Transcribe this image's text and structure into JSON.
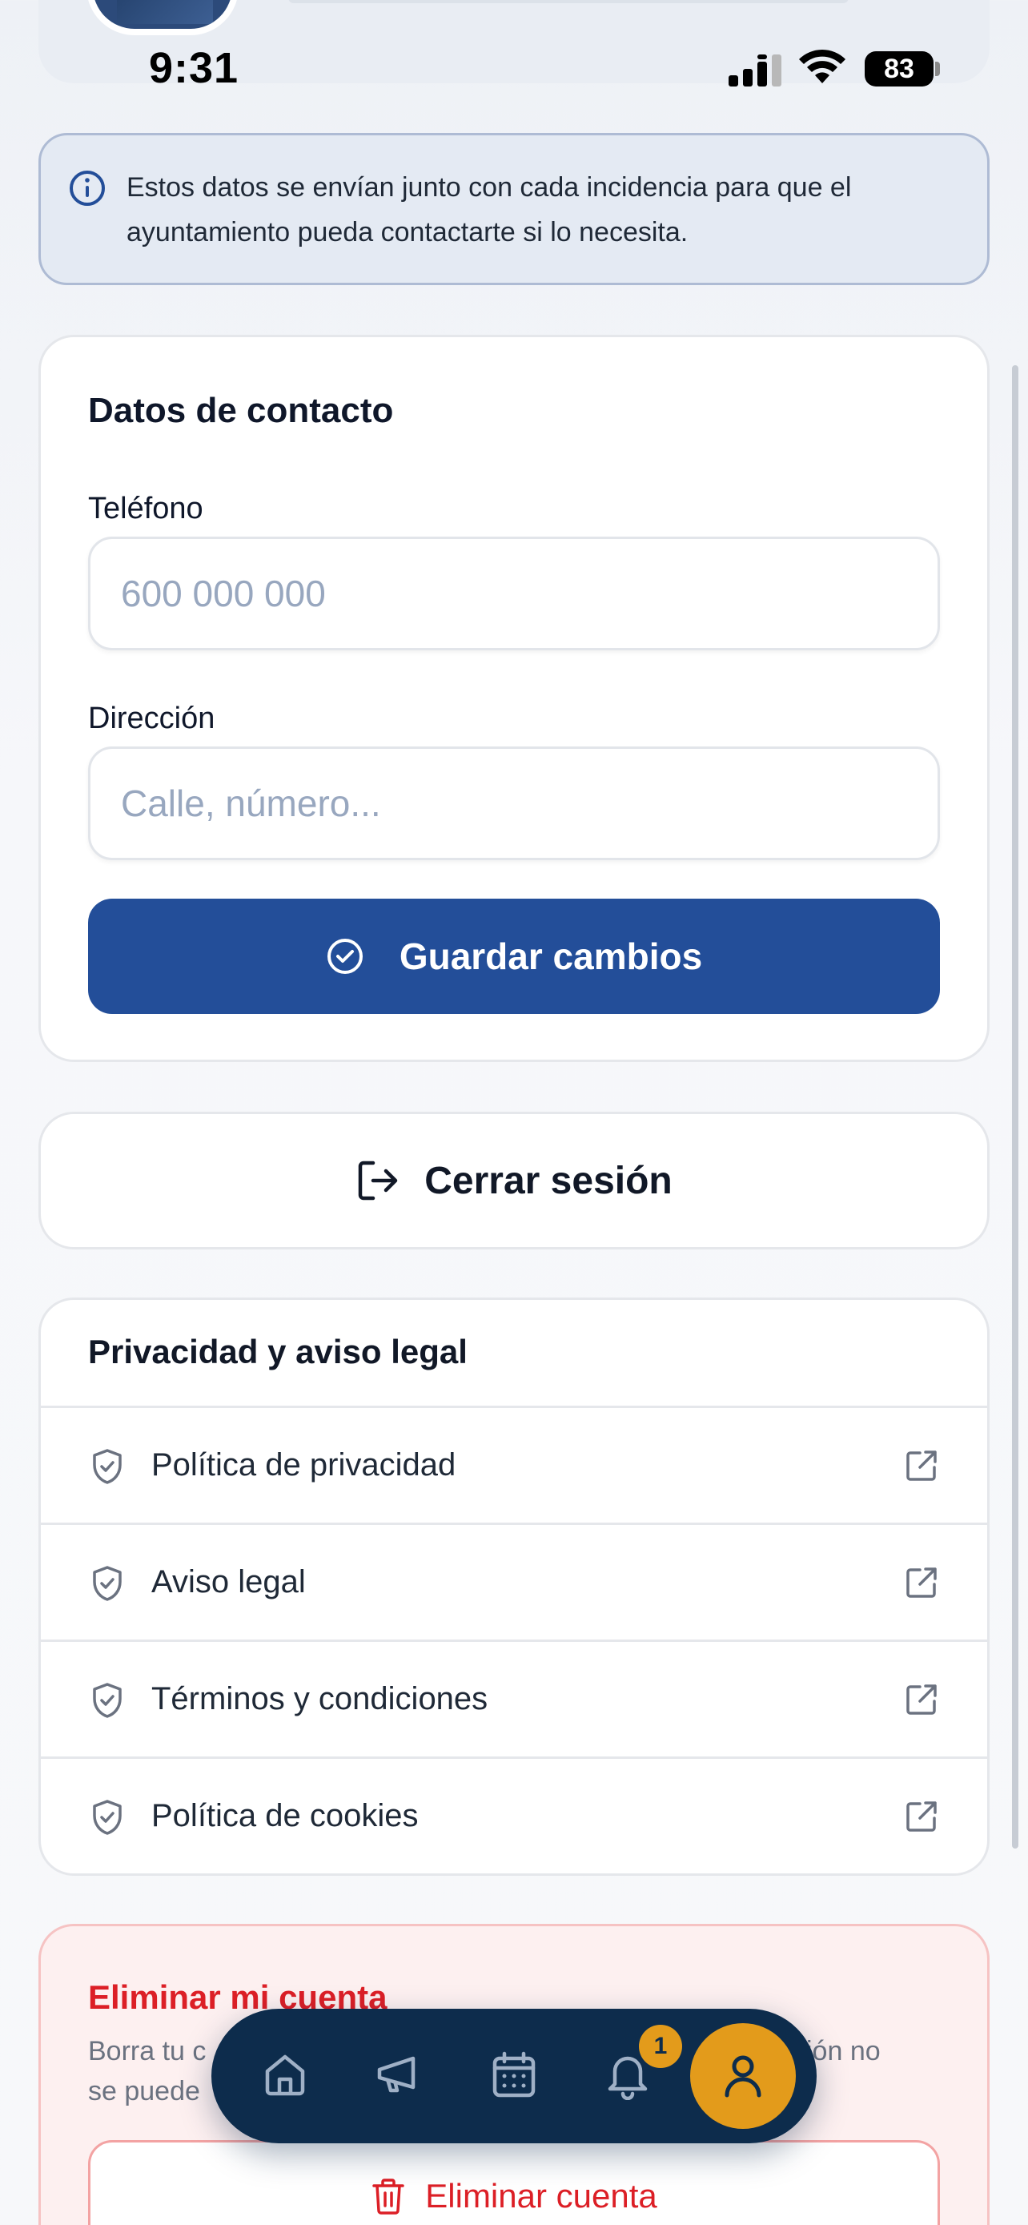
{
  "status_bar": {
    "time": "9:31",
    "battery": "83"
  },
  "info_banner": {
    "icon": "info-icon",
    "text": "Estos datos se envían junto con cada incidencia para que el ayuntamiento pueda contactarte si lo necesita."
  },
  "contact": {
    "title": "Datos de contacto",
    "phone_label": "Teléfono",
    "phone_value": "",
    "phone_placeholder": "600 000 000",
    "address_label": "Dirección",
    "address_value": "",
    "address_placeholder": "Calle, número...",
    "save_label": "Guardar cambios"
  },
  "logout": {
    "label": "Cerrar sesión"
  },
  "legal": {
    "title": "Privacidad y aviso legal",
    "items": [
      {
        "label": "Política de privacidad"
      },
      {
        "label": "Aviso legal"
      },
      {
        "label": "Términos y condiciones"
      },
      {
        "label": "Política de cookies"
      }
    ]
  },
  "delete_account": {
    "title": "Eliminar mi cuenta",
    "description_visible": [
      "Borra tu c",
      "ción no",
      "se puede"
    ],
    "button_label": "Eliminar cuenta"
  },
  "bottom_nav": {
    "items": [
      "home-icon",
      "megaphone-icon",
      "calendar-icon",
      "bell-icon",
      "user-icon"
    ],
    "active": "user-icon",
    "notifications_badge": "1",
    "accent_color": "#e39b1b",
    "background_color": "#0d2c4c"
  },
  "colors": {
    "primary": "#234e99",
    "danger": "#dc1f26"
  }
}
